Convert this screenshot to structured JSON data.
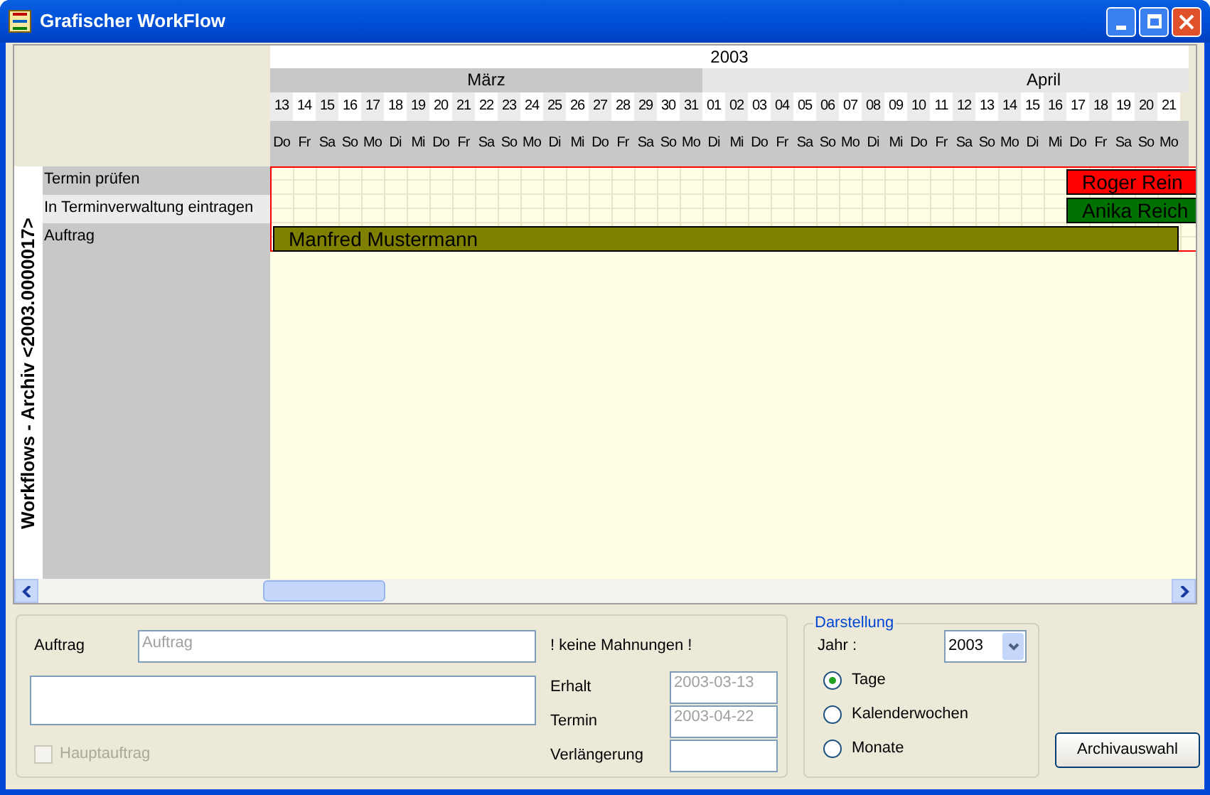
{
  "window": {
    "title": "Grafischer WorkFlow"
  },
  "side_label": "Workflows - Archiv <2003.0000017>",
  "timeline": {
    "year": "2003",
    "months": [
      {
        "label": "März",
        "days": [
          {
            "day": "13",
            "weekday": "Do"
          },
          {
            "day": "14",
            "weekday": "Fr"
          },
          {
            "day": "15",
            "weekday": "Sa"
          },
          {
            "day": "16",
            "weekday": "So"
          },
          {
            "day": "17",
            "weekday": "Mo"
          },
          {
            "day": "18",
            "weekday": "Di"
          },
          {
            "day": "19",
            "weekday": "Mi"
          },
          {
            "day": "20",
            "weekday": "Do"
          },
          {
            "day": "21",
            "weekday": "Fr"
          },
          {
            "day": "22",
            "weekday": "Sa"
          },
          {
            "day": "23",
            "weekday": "So"
          },
          {
            "day": "24",
            "weekday": "Mo"
          },
          {
            "day": "25",
            "weekday": "Di"
          },
          {
            "day": "26",
            "weekday": "Mi"
          },
          {
            "day": "27",
            "weekday": "Do"
          },
          {
            "day": "28",
            "weekday": "Fr"
          },
          {
            "day": "29",
            "weekday": "Sa"
          },
          {
            "day": "30",
            "weekday": "So"
          },
          {
            "day": "31",
            "weekday": "Mo"
          }
        ]
      },
      {
        "label": "April",
        "days": [
          {
            "day": "01",
            "weekday": "Di"
          },
          {
            "day": "02",
            "weekday": "Mi"
          },
          {
            "day": "03",
            "weekday": "Do"
          },
          {
            "day": "04",
            "weekday": "Fr"
          },
          {
            "day": "05",
            "weekday": "Sa"
          },
          {
            "day": "06",
            "weekday": "So"
          },
          {
            "day": "07",
            "weekday": "Mo"
          },
          {
            "day": "08",
            "weekday": "Di"
          },
          {
            "day": "09",
            "weekday": "Mi"
          },
          {
            "day": "10",
            "weekday": "Do"
          },
          {
            "day": "11",
            "weekday": "Fr"
          },
          {
            "day": "12",
            "weekday": "Sa"
          },
          {
            "day": "13",
            "weekday": "So"
          },
          {
            "day": "14",
            "weekday": "Mo"
          },
          {
            "day": "15",
            "weekday": "Di"
          },
          {
            "day": "16",
            "weekday": "Mi"
          },
          {
            "day": "17",
            "weekday": "Do"
          },
          {
            "day": "18",
            "weekday": "Fr"
          },
          {
            "day": "19",
            "weekday": "Sa"
          },
          {
            "day": "20",
            "weekday": "So"
          },
          {
            "day": "21",
            "weekday": "Mo"
          }
        ]
      }
    ]
  },
  "rows": [
    {
      "label": "Termin prüfen",
      "bar": {
        "label": "Roger Rein",
        "color": "#ff0000",
        "kind": "to-end",
        "level": 0.134
      }
    },
    {
      "label": "In Terminverwaltung eintragen",
      "bar": {
        "label": "Anika Reich",
        "color": "#007000",
        "kind": "to-end",
        "level": 0.134
      }
    },
    {
      "label": "Auftrag",
      "bar": {
        "label": "Manfred Mustermann",
        "color": "#808000",
        "kind": "from-start",
        "level": 0.986
      }
    }
  ],
  "form": {
    "auftrag_label": "Auftrag",
    "auftrag_placeholder": "Auftrag",
    "hauptauftrag": {
      "label": "Hauptauftrag",
      "checked": false,
      "disabled": true
    },
    "mahnungen": "! keine Mahnungen !",
    "dates": [
      {
        "label": "Erhalt",
        "value": "2003-03-13",
        "disabled": true
      },
      {
        "label": "Termin",
        "value": "2003-04-22",
        "disabled": true
      },
      {
        "label": "Verlängerung"
      }
    ]
  },
  "darstellung": {
    "title": "Darstellung",
    "year_label": "Jahr :",
    "year": "2003",
    "options": [
      {
        "label": "Tage",
        "selected": true
      },
      {
        "label": "Kalenderwochen",
        "selected": false
      },
      {
        "label": "Monate",
        "selected": false
      }
    ]
  },
  "buttons": [
    "Archivauswahl"
  ]
}
